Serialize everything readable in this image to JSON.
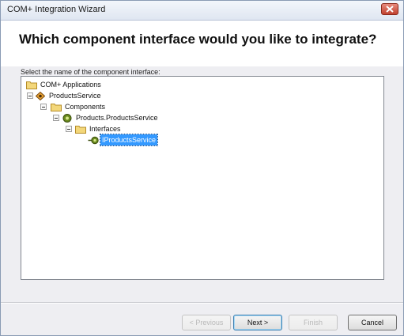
{
  "window": {
    "title": "COM+ Integration Wizard"
  },
  "header": {
    "heading": "Which component interface would you like to integrate?"
  },
  "instruction": "Select the name of the component interface:",
  "tree": {
    "nodes": [
      {
        "label": "COM+ Applications",
        "icon": "folder-icon",
        "expanded": true
      },
      {
        "label": "ProductsService",
        "icon": "com-application-icon",
        "expanded": true
      },
      {
        "label": "Components",
        "icon": "folder-icon",
        "expanded": true
      },
      {
        "label": "Products.ProductsService",
        "icon": "component-icon",
        "expanded": true
      },
      {
        "label": "Interfaces",
        "icon": "folder-icon",
        "expanded": true
      },
      {
        "label": "IProductsService",
        "icon": "interface-icon",
        "selected": true
      }
    ]
  },
  "buttons": {
    "previous": "< Previous",
    "next": "Next >",
    "finish": "Finish",
    "cancel": "Cancel"
  },
  "colors": {
    "selection": "#3399ff",
    "close_button": "#c0422f"
  }
}
